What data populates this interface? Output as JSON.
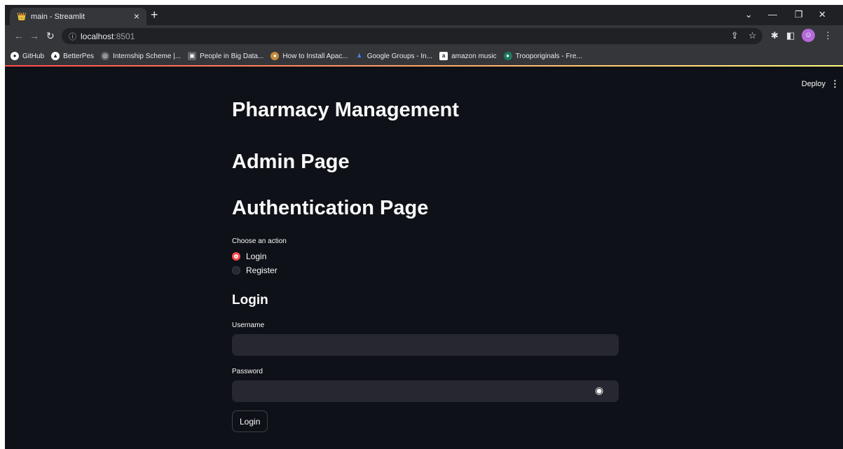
{
  "browser": {
    "tab_title": "main - Streamlit",
    "tab_close": "×",
    "new_tab": "+",
    "url_host": "localhost",
    "url_port": ":8501",
    "bookmarks": [
      {
        "label": "GitHub",
        "color": "#ffffff",
        "glyph": "●"
      },
      {
        "label": "BetterPes",
        "color": "#202124",
        "glyph": "▲"
      },
      {
        "label": "Internship Scheme |...",
        "color": "#5f6368",
        "glyph": "◎"
      },
      {
        "label": "People in Big Data...",
        "color": "#5f6368",
        "glyph": "▣"
      },
      {
        "label": "How to Install Apac...",
        "color": "#c58a3a",
        "glyph": "●"
      },
      {
        "label": "Google Groups - In...",
        "color": "#4285f4",
        "glyph": "♟"
      },
      {
        "label": "amazon music",
        "color": "#ffffff",
        "glyph": "a"
      },
      {
        "label": "Trooporiginals - Fre...",
        "color": "#1d7a5f",
        "glyph": "●"
      }
    ]
  },
  "header": {
    "deploy_label": "Deploy",
    "menu_icon": "⋮"
  },
  "main": {
    "title": "Pharmacy Management",
    "subtitle": "Admin Page",
    "section_title": "Authentication Page",
    "radio_label": "Choose an action",
    "radio_options": [
      "Login",
      "Register"
    ],
    "selected_option": "Login",
    "form_title": "Login",
    "username_label": "Username",
    "username_value": "",
    "password_label": "Password",
    "password_value": "",
    "login_button": "Login"
  },
  "colors": {
    "background": "#0e1117",
    "input_bg": "#262730",
    "accent": "#ff4b4b"
  }
}
